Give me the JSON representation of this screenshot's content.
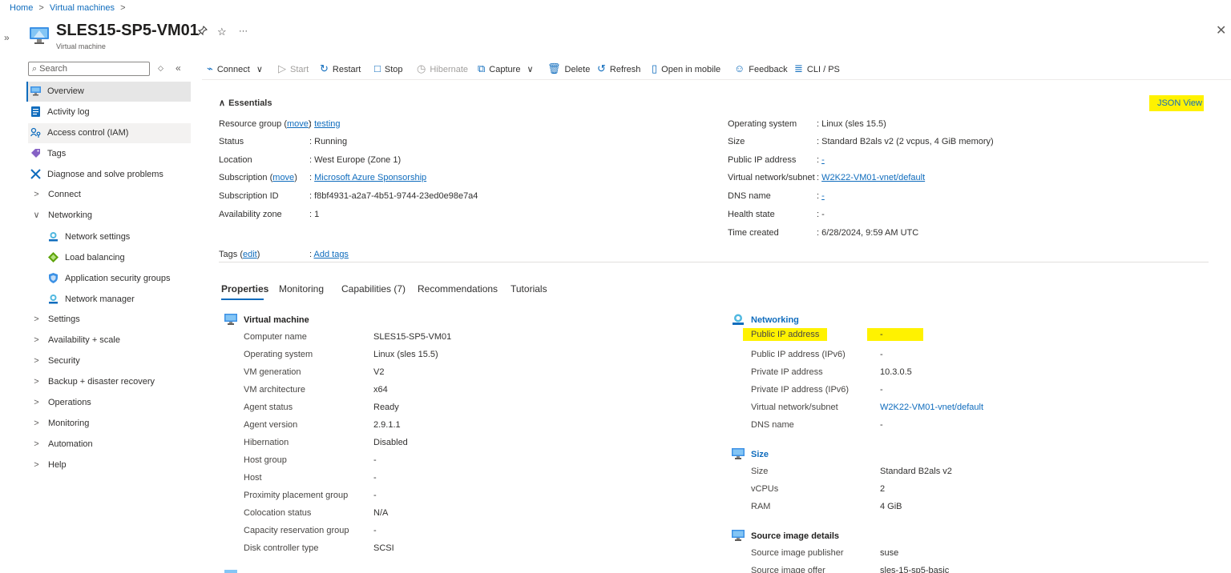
{
  "breadcrumb": {
    "home": "Home",
    "sep1": ">",
    "vms": "Virtual machines",
    "sep2": ">"
  },
  "rail": {
    "expand": "»"
  },
  "title": {
    "name": "SLES15-SP5-VM01",
    "subtitle": "Virtual machine",
    "pin": "✰",
    "star": "☆",
    "more": "···",
    "close": "✕"
  },
  "search": {
    "icon": "⌕",
    "placeholder": "Search",
    "expand": "◇",
    "collapse": "«"
  },
  "nav": {
    "overview": "Overview",
    "activity_log": "Activity log",
    "access_control": "Access control (IAM)",
    "tags": "Tags",
    "diagnose": "Diagnose and solve problems",
    "connect": "Connect",
    "networking": "Networking",
    "network_settings": "Network settings",
    "load_balancing": "Load balancing",
    "asg": "Application security groups",
    "network_manager": "Network manager",
    "settings": "Settings",
    "availability": "Availability + scale",
    "security": "Security",
    "backup": "Backup + disaster recovery",
    "operations": "Operations",
    "monitoring": "Monitoring",
    "automation": "Automation",
    "help": "Help",
    "chev_right": ">",
    "chev_down": "∨"
  },
  "toolbar": {
    "connect": "Connect",
    "connect_chev": "∨",
    "start": "Start",
    "restart": "Restart",
    "stop": "Stop",
    "hibernate": "Hibernate",
    "capture": "Capture",
    "capture_chev": "∨",
    "delete": "Delete",
    "refresh": "Refresh",
    "open_mobile": "Open in mobile",
    "feedback": "Feedback",
    "cli": "CLI / PS"
  },
  "essentials": {
    "toggle": "Essentials",
    "toggle_icon": "∧",
    "json_view": "JSON View",
    "left": {
      "rg_label": "Resource group",
      "rg_move": "move",
      "rg_paren_open": "(",
      "rg_paren_close": ")",
      "rg_value": "testing",
      "status_label": "Status",
      "status_value": "Running",
      "location_label": "Location",
      "location_value": "West Europe (Zone 1)",
      "sub_label": "Subscription",
      "sub_move": "move",
      "sub_value": "Microsoft Azure Sponsorship",
      "subid_label": "Subscription ID",
      "subid_value": "f8bf4931-a2a7-4b51-9744-23ed0e98e7a4",
      "az_label": "Availability zone",
      "az_value": "1",
      "tags_label": "Tags",
      "tags_edit": "edit",
      "tags_value": "Add tags",
      "colon": ":"
    },
    "right": {
      "os_label": "Operating system",
      "os_value": "Linux (sles 15.5)",
      "size_label": "Size",
      "size_value": "Standard B2als v2 (2 vcpus, 4 GiB memory)",
      "pip_label": "Public IP address",
      "pip_value": "-",
      "vnet_label": "Virtual network/subnet",
      "vnet_value": "W2K22-VM01-vnet/default",
      "dns_label": "DNS name",
      "dns_value": "-",
      "health_label": "Health state",
      "health_value": "-",
      "created_label": "Time created",
      "created_value": "6/28/2024, 9:59 AM UTC"
    }
  },
  "tabs": [
    "Properties",
    "Monitoring",
    "Capabilities (7)",
    "Recommendations",
    "Tutorials"
  ],
  "vm_section": {
    "title": "Virtual machine",
    "rows": [
      {
        "label": "Computer name",
        "value": "SLES15-SP5-VM01"
      },
      {
        "label": "Operating system",
        "value": "Linux (sles 15.5)"
      },
      {
        "label": "VM generation",
        "value": "V2"
      },
      {
        "label": "VM architecture",
        "value": "x64"
      },
      {
        "label": "Agent status",
        "value": "Ready"
      },
      {
        "label": "Agent version",
        "value": "2.9.1.1"
      },
      {
        "label": "Hibernation",
        "value": "Disabled"
      },
      {
        "label": "Host group",
        "value": "-"
      },
      {
        "label": "Host",
        "value": "-"
      },
      {
        "label": "Proximity placement group",
        "value": "-"
      },
      {
        "label": "Colocation status",
        "value": "N/A"
      },
      {
        "label": "Capacity reservation group",
        "value": "-"
      },
      {
        "label": "Disk controller type",
        "value": "SCSI"
      }
    ]
  },
  "networking_section": {
    "title": "Networking",
    "rows": [
      {
        "label": "Public IP address",
        "value": "-"
      },
      {
        "label": "Public IP address (IPv6)",
        "value": "-"
      },
      {
        "label": "Private IP address",
        "value": "10.3.0.5"
      },
      {
        "label": "Private IP address (IPv6)",
        "value": "-"
      },
      {
        "label": "Virtual network/subnet",
        "value": "W2K22-VM01-vnet/default"
      },
      {
        "label": "DNS name",
        "value": "-"
      }
    ]
  },
  "size_section": {
    "title": "Size",
    "rows": [
      {
        "label": "Size",
        "value": "Standard B2als v2"
      },
      {
        "label": "vCPUs",
        "value": "2"
      },
      {
        "label": "RAM",
        "value": "4 GiB"
      }
    ]
  },
  "image_section": {
    "title": "Source image details",
    "rows": [
      {
        "label": "Source image publisher",
        "value": "suse"
      },
      {
        "label": "Source image offer",
        "value": "sles-15-sp5-basic"
      }
    ]
  },
  "colors": {
    "accent": "#0f6cbd",
    "highlight": "#fff200",
    "nav_active": "#e6e6e6"
  }
}
